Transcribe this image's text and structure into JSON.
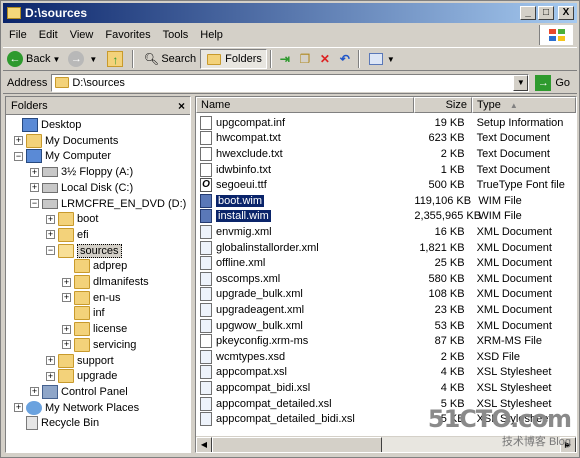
{
  "window": {
    "title": "D:\\sources",
    "buttons": {
      "minimize": "_",
      "maximize": "□",
      "close": "X"
    }
  },
  "menu": [
    "File",
    "Edit",
    "View",
    "Favorites",
    "Tools",
    "Help"
  ],
  "toolbar": {
    "back_label": "Back",
    "search_label": "Search",
    "folders_label": "Folders"
  },
  "address": {
    "label": "Address",
    "value": "D:\\sources",
    "go_label": "Go"
  },
  "folders_pane": {
    "header": "Folders",
    "close": "×",
    "tree": [
      {
        "label": "Desktop",
        "expander": "",
        "icon": "desktop-icon"
      },
      {
        "label": "My Documents",
        "expander": "+",
        "icon": "folder-icon"
      },
      {
        "label": "My Computer",
        "expander": "−",
        "icon": "computer-icon"
      },
      {
        "label": "3½ Floppy (A:)",
        "expander": "+",
        "icon": "floppy-icon"
      },
      {
        "label": "Local Disk (C:)",
        "expander": "+",
        "icon": "drive-icon"
      },
      {
        "label": "LRMCFRE_EN_DVD (D:)",
        "expander": "−",
        "icon": "dvd-icon"
      },
      {
        "label": "boot",
        "expander": "+",
        "icon": "folder-icon"
      },
      {
        "label": "efi",
        "expander": "+",
        "icon": "folder-icon"
      },
      {
        "label": "sources",
        "expander": "−",
        "icon": "folder-open-icon"
      },
      {
        "label": "adprep",
        "expander": "",
        "icon": "folder-icon"
      },
      {
        "label": "dlmanifests",
        "expander": "+",
        "icon": "folder-icon"
      },
      {
        "label": "en-us",
        "expander": "+",
        "icon": "folder-icon"
      },
      {
        "label": "inf",
        "expander": "",
        "icon": "folder-icon"
      },
      {
        "label": "license",
        "expander": "+",
        "icon": "folder-icon"
      },
      {
        "label": "servicing",
        "expander": "+",
        "icon": "folder-icon"
      },
      {
        "label": "support",
        "expander": "+",
        "icon": "folder-icon"
      },
      {
        "label": "upgrade",
        "expander": "+",
        "icon": "folder-icon"
      },
      {
        "label": "Control Panel",
        "expander": "+",
        "icon": "control-panel-icon"
      },
      {
        "label": "My Network Places",
        "expander": "+",
        "icon": "network-icon"
      },
      {
        "label": "Recycle Bin",
        "expander": "",
        "icon": "recycle-bin-icon"
      }
    ]
  },
  "file_list": {
    "columns": {
      "name": "Name",
      "size": "Size",
      "type": "Type"
    },
    "rows": [
      {
        "name": "upgcompat.inf",
        "size": "19 KB",
        "type": "Setup Information",
        "icon": "inf-file-icon"
      },
      {
        "name": "hwcompat.txt",
        "size": "623 KB",
        "type": "Text Document",
        "icon": "text-file-icon"
      },
      {
        "name": "hwexclude.txt",
        "size": "2 KB",
        "type": "Text Document",
        "icon": "text-file-icon"
      },
      {
        "name": "idwbinfo.txt",
        "size": "1 KB",
        "type": "Text Document",
        "icon": "text-file-icon"
      },
      {
        "name": "segoeui.ttf",
        "size": "500 KB",
        "type": "TrueType Font file",
        "icon": "font-file-icon"
      },
      {
        "name": "boot.wim",
        "size": "119,106 KB",
        "type": "WIM File",
        "icon": "wim-file-icon"
      },
      {
        "name": "install.wim",
        "size": "2,355,965 KB",
        "type": "WIM File",
        "icon": "wim-file-icon"
      },
      {
        "name": "envmig.xml",
        "size": "16 KB",
        "type": "XML Document",
        "icon": "xml-file-icon"
      },
      {
        "name": "globalinstallorder.xml",
        "size": "1,821 KB",
        "type": "XML Document",
        "icon": "xml-file-icon"
      },
      {
        "name": "offline.xml",
        "size": "25 KB",
        "type": "XML Document",
        "icon": "xml-file-icon"
      },
      {
        "name": "oscomps.xml",
        "size": "580 KB",
        "type": "XML Document",
        "icon": "xml-file-icon"
      },
      {
        "name": "upgrade_bulk.xml",
        "size": "108 KB",
        "type": "XML Document",
        "icon": "xml-file-icon"
      },
      {
        "name": "upgradeagent.xml",
        "size": "23 KB",
        "type": "XML Document",
        "icon": "xml-file-icon"
      },
      {
        "name": "upgwow_bulk.xml",
        "size": "53 KB",
        "type": "XML Document",
        "icon": "xml-file-icon"
      },
      {
        "name": "pkeyconfig.xrm-ms",
        "size": "87 KB",
        "type": "XRM-MS File",
        "icon": "xrm-file-icon"
      },
      {
        "name": "wcmtypes.xsd",
        "size": "2 KB",
        "type": "XSD File",
        "icon": "xsd-file-icon"
      },
      {
        "name": "appcompat.xsl",
        "size": "4 KB",
        "type": "XSL Stylesheet",
        "icon": "xsl-file-icon"
      },
      {
        "name": "appcompat_bidi.xsl",
        "size": "4 KB",
        "type": "XSL Stylesheet",
        "icon": "xsl-file-icon"
      },
      {
        "name": "appcompat_detailed.xsl",
        "size": "5 KB",
        "type": "XSL Stylesheet",
        "icon": "xsl-file-icon"
      },
      {
        "name": "appcompat_detailed_bidi.xsl",
        "size": "5 KB",
        "type": "XSL Stylesheet",
        "icon": "xsl-file-icon"
      }
    ],
    "selected": [
      "boot.wim",
      "install.wim"
    ]
  },
  "watermark": {
    "logo": "51CTO.com",
    "subtitle": "技术博客",
    "extra": "Blog"
  },
  "colors": {
    "selection": "#0a246a",
    "title_gradient_start": "#0a246a",
    "title_gradient_end": "#a6caf0",
    "chrome": "#d4d0c8"
  }
}
